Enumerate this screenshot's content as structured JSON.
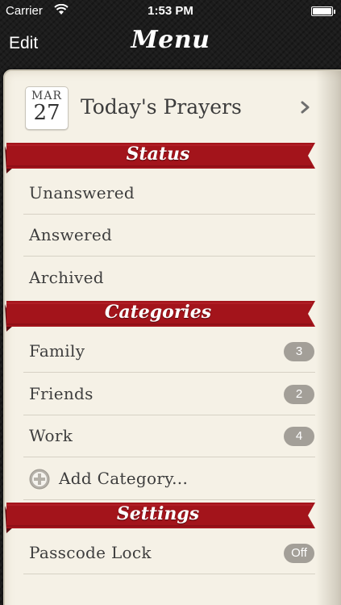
{
  "status_bar": {
    "carrier": "Carrier",
    "time": "1:53 PM"
  },
  "nav": {
    "edit_label": "Edit",
    "title": "Menu"
  },
  "today": {
    "month": "MAR",
    "day": "27",
    "label": "Today's Prayers",
    "icon": "chevron-right-icon"
  },
  "sections": {
    "status": {
      "title": "Status",
      "items": [
        {
          "label": "Unanswered"
        },
        {
          "label": "Answered"
        },
        {
          "label": "Archived"
        }
      ]
    },
    "categories": {
      "title": "Categories",
      "items": [
        {
          "label": "Family",
          "count": "3"
        },
        {
          "label": "Friends",
          "count": "2"
        },
        {
          "label": "Work",
          "count": "4"
        }
      ],
      "add_label": "Add Category..."
    },
    "settings": {
      "title": "Settings",
      "items": [
        {
          "label": "Passcode Lock",
          "value": "Off"
        }
      ]
    }
  },
  "colors": {
    "ribbon": "#a3141b",
    "paper": "#f5f1e6",
    "badge": "#a39f98"
  }
}
